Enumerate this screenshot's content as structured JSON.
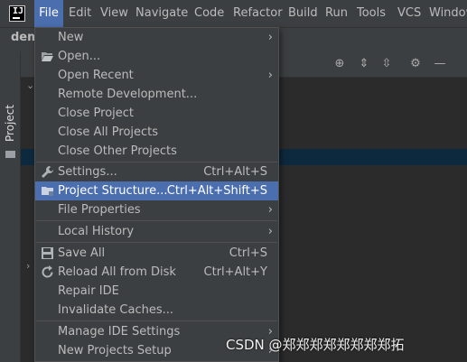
{
  "menubar": {
    "items": [
      "File",
      "Edit",
      "View",
      "Navigate",
      "Code",
      "Refactor",
      "Build",
      "Run",
      "Tools",
      "VCS",
      "Window"
    ]
  },
  "navbar": {
    "crumb": "dem"
  },
  "toolstrip": {
    "label": "Project"
  },
  "file_menu": {
    "items": [
      {
        "label": "New",
        "shortcut": "",
        "submenu": true,
        "icon": ""
      },
      {
        "label": "Open...",
        "shortcut": "",
        "submenu": false,
        "icon": "folder-open-icon"
      },
      {
        "label": "Open Recent",
        "shortcut": "",
        "submenu": true,
        "icon": ""
      },
      {
        "label": "Remote Development...",
        "shortcut": "",
        "submenu": false,
        "icon": ""
      },
      {
        "label": "Close Project",
        "shortcut": "",
        "submenu": false,
        "icon": ""
      },
      {
        "label": "Close All Projects",
        "shortcut": "",
        "submenu": false,
        "icon": ""
      },
      {
        "label": "Close Other Projects",
        "shortcut": "",
        "submenu": false,
        "icon": ""
      },
      {
        "label": "Settings...",
        "shortcut": "Ctrl+Alt+S",
        "submenu": false,
        "icon": "wrench-icon"
      },
      {
        "label": "Project Structure...",
        "shortcut": "Ctrl+Alt+Shift+S",
        "submenu": false,
        "icon": "project-structure-icon",
        "selected": true
      },
      {
        "label": "File Properties",
        "shortcut": "",
        "submenu": true,
        "icon": ""
      },
      {
        "label": "Local History",
        "shortcut": "",
        "submenu": true,
        "icon": ""
      },
      {
        "label": "Save All",
        "shortcut": "Ctrl+S",
        "submenu": false,
        "icon": "save-icon"
      },
      {
        "label": "Reload All from Disk",
        "shortcut": "Ctrl+Alt+Y",
        "submenu": false,
        "icon": "reload-icon"
      },
      {
        "label": "Repair IDE",
        "shortcut": "",
        "submenu": false,
        "icon": ""
      },
      {
        "label": "Invalidate Caches...",
        "shortcut": "",
        "submenu": false,
        "icon": ""
      },
      {
        "label": "Manage IDE Settings",
        "shortcut": "",
        "submenu": true,
        "icon": ""
      },
      {
        "label": "New Projects Setup",
        "shortcut": "",
        "submenu": true,
        "icon": ""
      }
    ]
  },
  "watermark": "CSDN @郑郑郑郑郑郑郑郑拓",
  "colors": {
    "selection": "#4b6eaf",
    "menu_bg": "#3c3f41",
    "editor_bg": "#2b2b2b"
  }
}
